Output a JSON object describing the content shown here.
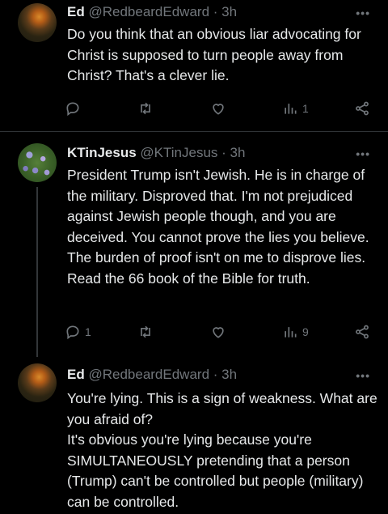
{
  "tweets": [
    {
      "name": "Ed",
      "handle": "@RedbeardEdward",
      "time": "· 3h",
      "more": "•••",
      "text": [
        "Do you think that an obvious liar advocating for Christ is supposed to turn people away from Christ? That's a clever lie."
      ],
      "replies": "",
      "reposts": "",
      "likes": "",
      "views": "1"
    },
    {
      "name": "KTinJesus",
      "handle": "@KTinJesus",
      "time": "· 3h",
      "more": "•••",
      "text": [
        "President Trump isn't Jewish. He is in charge of the military. Disproved that. I'm not prejudiced against Jewish people though, and you are deceived. You cannot prove the lies you believe. The burden of proof isn't on me to disprove lies. Read the 66 book of the Bible for truth."
      ],
      "replies": "1",
      "reposts": "",
      "likes": "",
      "views": "9"
    },
    {
      "name": "Ed",
      "handle": "@RedbeardEdward",
      "time": "· 3h",
      "more": "•••",
      "text": [
        "You're lying. This is a sign of weakness. What are you afraid of?",
        "It's obvious you're lying because you're SIMULTANEOUSLY pretending that a person (Trump) can't be controlled but people (military) can be controlled."
      ]
    }
  ],
  "icons": {
    "reply": "reply-icon",
    "repost": "repost-icon",
    "like": "like-icon",
    "views": "views-icon",
    "share": "share-icon"
  }
}
